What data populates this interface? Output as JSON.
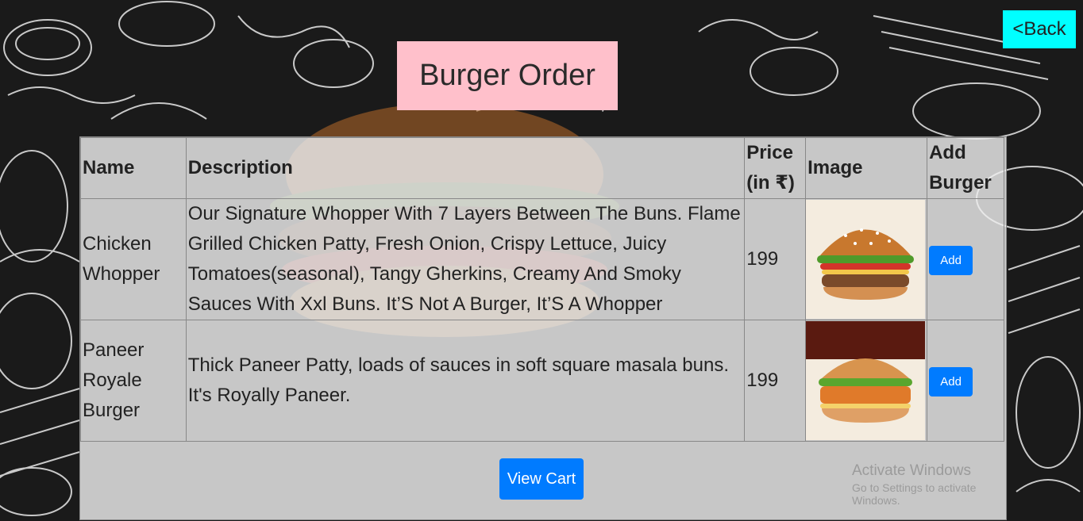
{
  "page": {
    "back_label": "<Back",
    "title": "Burger Order",
    "view_cart_label": "View Cart"
  },
  "table": {
    "headers": {
      "name": "Name",
      "description": "Description",
      "price": "Price (in ₹)",
      "image": "Image",
      "add": "Add Burger"
    },
    "rows": [
      {
        "name": "Chicken Whopper",
        "description": "Our Signature Whopper With 7 Layers Between The Buns. Flame Grilled Chicken Patty, Fresh Onion, Crispy Lettuce, Juicy Tomatoes(seasonal), Tangy Gherkins, Creamy And Smoky Sauces With Xxl Buns. It’S Not A Burger, It’S A Whopper",
        "price": "199",
        "image_icon": "burger-photo",
        "add_label": "Add"
      },
      {
        "name": "Paneer Royale Burger",
        "description": "Thick Paneer Patty, loads of sauces in soft square masala buns. It's Royally Paneer.",
        "price": "199",
        "image_icon": "burger-photo",
        "add_label": "Add"
      }
    ]
  },
  "watermark": {
    "line1": "Activate Windows",
    "line2": "Go to Settings to activate Windows."
  },
  "colors": {
    "back_button": "#00ffff",
    "title_box": "#ffc0cb",
    "primary_button": "#007bff",
    "background": "#1a1a1a"
  }
}
